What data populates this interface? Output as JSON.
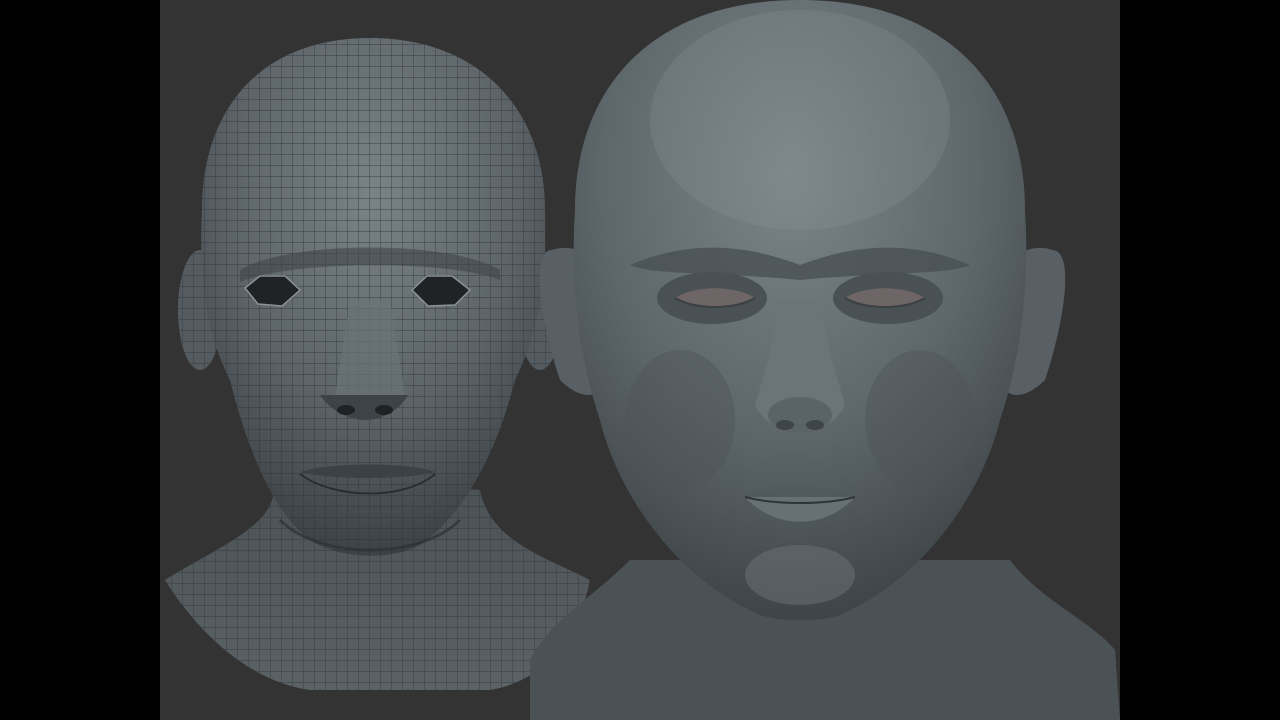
{
  "scene": {
    "background_color": "#333333",
    "letterbox_color": "#000000",
    "models": [
      {
        "name": "low-poly-wireframe-head",
        "base_color": "#5c6469",
        "wire_color": "#2e3236"
      },
      {
        "name": "high-poly-sculpted-head",
        "base_color": "#5e676b"
      }
    ]
  }
}
